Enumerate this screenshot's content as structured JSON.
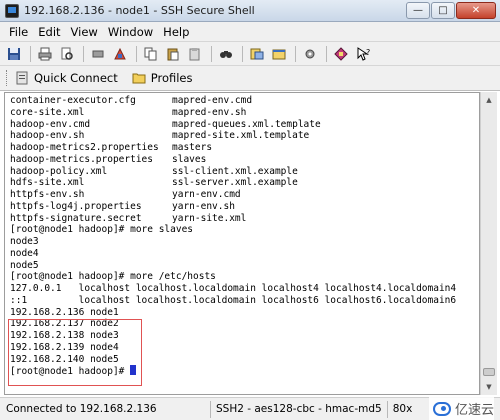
{
  "window": {
    "title": "192.168.2.136 - node1 - SSH Secure Shell",
    "minimize": "—",
    "maximize": "□",
    "close": "✕"
  },
  "menu": [
    "File",
    "Edit",
    "View",
    "Window",
    "Help"
  ],
  "toolbar_icons": [
    "save-icon",
    "print-icon",
    "find-file-icon",
    "disconnect-icon",
    "copy-icon",
    "paste-icon",
    "paste-alt-icon",
    "find-icon",
    "file-transfer-icon",
    "new-window-icon",
    "settings-icon",
    "help-book-icon",
    "whats-this-icon"
  ],
  "profilebar": {
    "quick_connect": "Quick Connect",
    "profiles": "Profiles"
  },
  "terminal": {
    "listing": [
      [
        "container-executor.cfg",
        "mapred-env.cmd"
      ],
      [
        "core-site.xml",
        "mapred-env.sh"
      ],
      [
        "hadoop-env.cmd",
        "mapred-queues.xml.template"
      ],
      [
        "hadoop-env.sh",
        "mapred-site.xml.template"
      ],
      [
        "hadoop-metrics2.properties",
        "masters"
      ],
      [
        "hadoop-metrics.properties",
        "slaves"
      ],
      [
        "hadoop-policy.xml",
        "ssl-client.xml.example"
      ],
      [
        "hdfs-site.xml",
        "ssl-server.xml.example"
      ],
      [
        "httpfs-env.sh",
        "yarn-env.cmd"
      ],
      [
        "httpfs-log4j.properties",
        "yarn-env.sh"
      ],
      [
        "httpfs-signature.secret",
        "yarn-site.xml"
      ]
    ],
    "cmd_slaves": "[root@node1 hadoop]# more slaves",
    "slaves_output": [
      "node3",
      "node4",
      "node5"
    ],
    "cmd_hosts": "[root@node1 hadoop]# more /etc/hosts",
    "hosts_default": [
      "127.0.0.1   localhost localhost.localdomain localhost4 localhost4.localdomain4",
      "::1         localhost localhost.localdomain localhost6 localhost6.localdomain6"
    ],
    "hosts_custom": [
      "192.168.2.136 node1",
      "192.168.2.137 node2",
      "192.168.2.138 node3",
      "192.168.2.139 node4",
      "192.168.2.140 node5"
    ],
    "prompt": "[root@node1 hadoop]# "
  },
  "status": {
    "connection": "Connected to 192.168.2.136",
    "protocol": "SSH2 - aes128-cbc - hmac-md5",
    "size": "80x"
  },
  "watermark": "亿速云",
  "colors": {
    "highlight_box": "#e05252",
    "cursor": "#2233cc"
  }
}
